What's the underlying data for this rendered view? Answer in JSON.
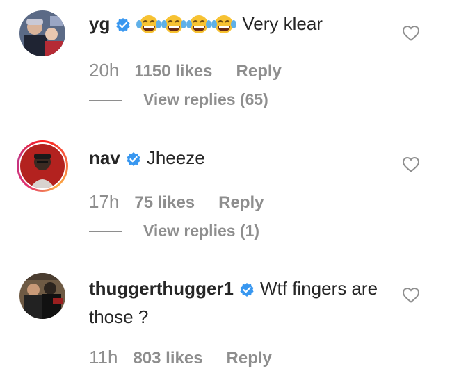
{
  "comments": [
    {
      "username": "yg",
      "text": "Very klear",
      "emoji_prefix": [
        "joy-emoji",
        "joy-emoji",
        "joy-emoji",
        "joy-emoji"
      ],
      "time": "20h",
      "likes": "1150 likes",
      "reply": "Reply",
      "view_replies": "View replies (65)"
    },
    {
      "username": "nav",
      "text": "Jheeze",
      "time": "17h",
      "likes": "75 likes",
      "reply": "Reply",
      "view_replies": "View replies (1)"
    },
    {
      "username": "thuggerthugger1",
      "text": "Wtf fingers are those ?",
      "time": "11h",
      "likes": "803 likes",
      "reply": "Reply"
    }
  ],
  "colors": {
    "text": "#262626",
    "muted": "#8e8e8e",
    "verified": "#3897f0"
  },
  "icons": [
    "verified-badge-icon",
    "heart-icon",
    "joy-emoji"
  ]
}
